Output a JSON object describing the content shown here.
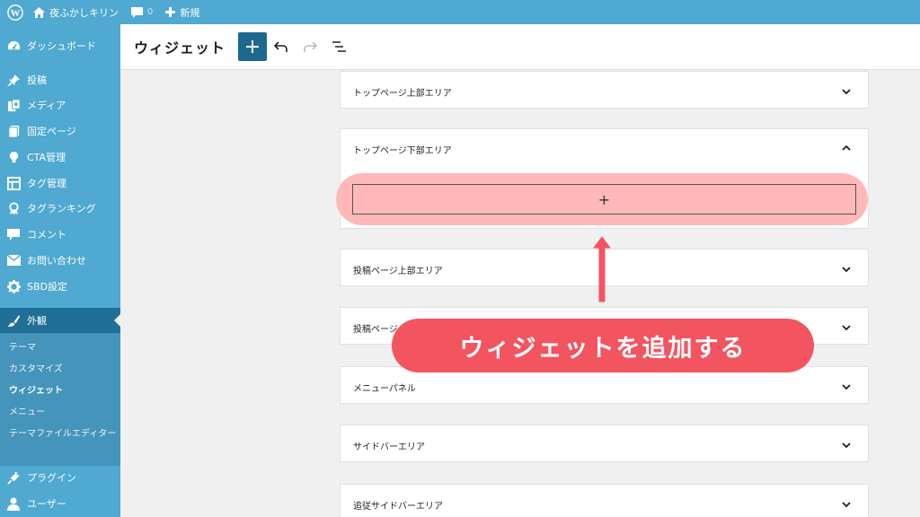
{
  "adminbar": {
    "site_name": "夜ふかしキリン",
    "comments_count": "0",
    "new_label": "新規"
  },
  "sidebar": {
    "items": [
      {
        "label": "ダッシュボード",
        "icon": "dashboard-icon"
      },
      {
        "label": "投稿",
        "icon": "pin-icon"
      },
      {
        "label": "メディア",
        "icon": "media-icon"
      },
      {
        "label": "固定ページ",
        "icon": "pages-icon"
      },
      {
        "label": "CTA管理",
        "icon": "lightbulb-icon"
      },
      {
        "label": "タグ管理",
        "icon": "layout-icon"
      },
      {
        "label": "タグランキング",
        "icon": "award-icon"
      },
      {
        "label": "コメント",
        "icon": "comment-icon"
      },
      {
        "label": "お問い合わせ",
        "icon": "mail-icon"
      },
      {
        "label": "SBD設定",
        "icon": "gear-icon"
      },
      {
        "label": "外観",
        "icon": "brush-icon"
      },
      {
        "label": "プラグイン",
        "icon": "plugin-icon"
      },
      {
        "label": "ユーザー",
        "icon": "user-icon"
      }
    ],
    "submenu": [
      "テーマ",
      "カスタマイズ",
      "ウィジェット",
      "メニュー",
      "テーマファイルエディター"
    ]
  },
  "header": {
    "title": "ウィジェット"
  },
  "areas": [
    "トップページ上部エリア",
    "トップページ下部エリア",
    "投稿ページ上部エリア",
    "投稿ページ",
    "メニューパネル",
    "サイドバーエリア",
    "追従サイドバーエリア"
  ],
  "appender_symbol": "+",
  "callout_text": "ウィジェットを追加する",
  "colors": {
    "admin_blue": "#4fa9d1",
    "active_menu": "#1f6f96",
    "add_button": "#1d6a8e",
    "callout_red": "#f25560",
    "highlight_pink": "#ffb8b8",
    "arrow_red": "#f25560"
  }
}
